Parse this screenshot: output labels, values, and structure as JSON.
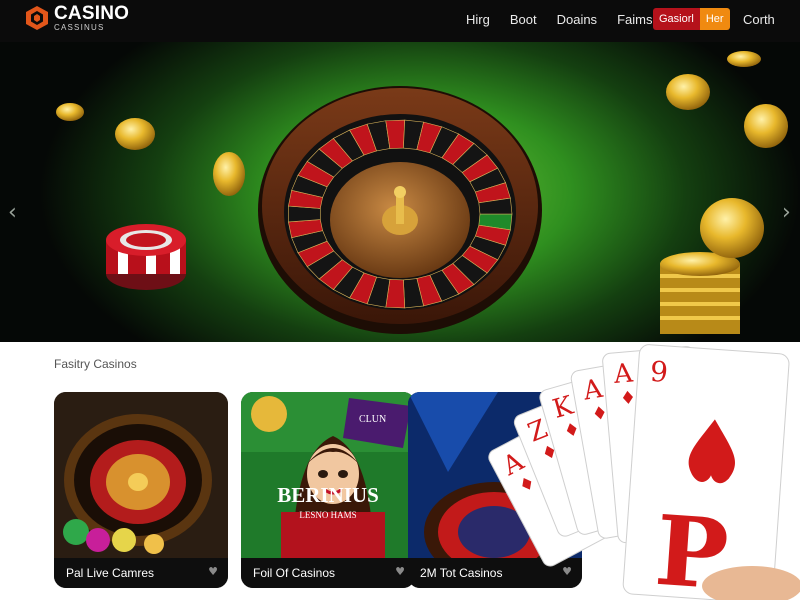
{
  "header": {
    "brand_title": "CASINO",
    "brand_subtitle": "CASSINUS",
    "nav": [
      "Hirg",
      "Boot",
      "Doains",
      "Faims"
    ],
    "cta_primary": "Gasiorl",
    "cta_secondary": "Her",
    "search_link": "Corth"
  },
  "hero": {
    "icons": [
      "roulette-wheel-icon",
      "casino-chip-stack-icon",
      "gold-coin-icon"
    ],
    "prev": "‹",
    "next": "›"
  },
  "section": {
    "title": "Fasitry Casinos"
  },
  "cards": [
    {
      "label": "Pal Live Camres",
      "icon": "roulette-wheel-icon"
    },
    {
      "label": "Foil Of Casinos",
      "art_title": "BERINIUS",
      "art_sub": "LESNO HAMS",
      "art_banner": "CLUN",
      "icon": "character-portrait-icon"
    },
    {
      "label": "2M Tot Casinos",
      "icon": "roulette-wheel-icon"
    }
  ],
  "playing_cards": {
    "ranks": [
      "A",
      "Z",
      "K",
      "A",
      "A",
      "9"
    ],
    "letter": "P"
  },
  "colors": {
    "header_bg": "#0b0b0b",
    "cta_red": "#b5121b",
    "cta_orange": "#f08a10",
    "felt_green": "#3a9a22",
    "wheel_red": "#c0141c",
    "gold": "#e0b12a"
  }
}
